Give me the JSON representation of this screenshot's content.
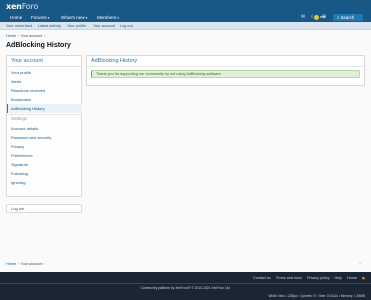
{
  "header": {
    "logo_main": "xen",
    "logo_sub": "Foro"
  },
  "nav": {
    "items": [
      {
        "label": "Home",
        "caret": ""
      },
      {
        "label": "Forums",
        "caret": "▾"
      },
      {
        "label": "What's new",
        "caret": "▾"
      },
      {
        "label": "Members",
        "caret": "▾"
      }
    ],
    "user": "ens",
    "search_label": "Search"
  },
  "subnav": {
    "items": [
      "Your news feed",
      "Latest activity",
      "Your profile",
      "Your account",
      "Log out"
    ]
  },
  "breadcrumbs": {
    "home": "Home",
    "account": "Your account",
    "separator": "›"
  },
  "page_title": "AdBlocking History",
  "sidebar": {
    "title": "Your account",
    "items": [
      "Your profile",
      "Alerts",
      "Reactions received",
      "Bookmarks",
      "AdBlocking History"
    ],
    "settings_label": "Settings",
    "settings_items": [
      "Account details",
      "Password and security",
      "Privacy",
      "Preferences",
      "Signature",
      "Following",
      "Ignoring"
    ],
    "logout": "Log out"
  },
  "main": {
    "title": "AdBlocking History",
    "notice": "Thank you for supporting our community by not using AdBlocking software."
  },
  "footer": {
    "links": [
      "Contact us",
      "Terms and rules",
      "Privacy policy",
      "Help",
      "Home"
    ],
    "copyright": "Community platform by XenForo® © 2010-2024 XenForo Ltd.",
    "stats": "Width: Max • 1280px • Queries: 9 • Time: 0.0111s • Memory: 1.39MB"
  }
}
